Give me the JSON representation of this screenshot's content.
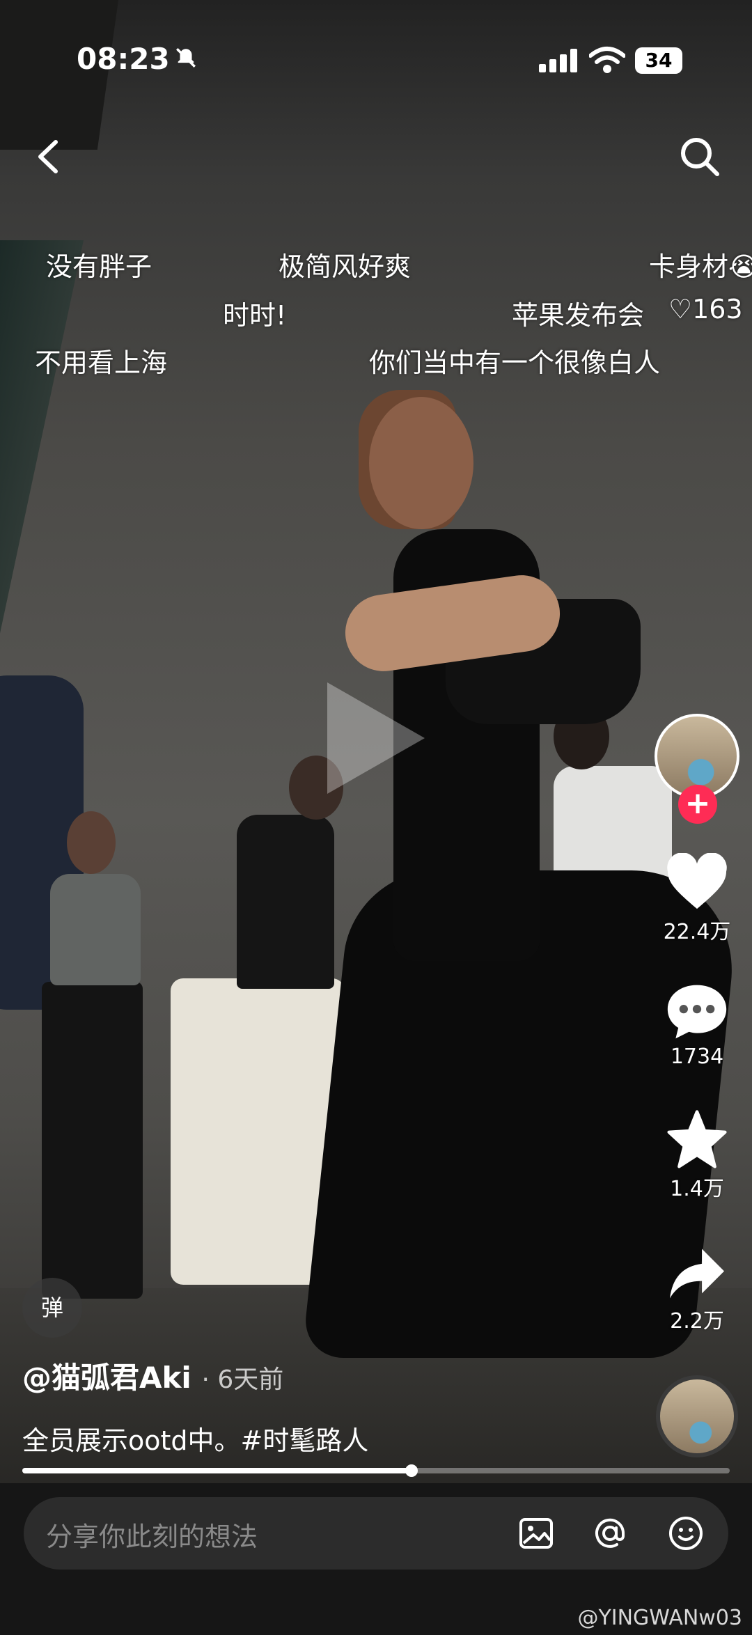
{
  "status_bar": {
    "time": "08:23",
    "battery": "34"
  },
  "danmaku": [
    "没有胖子",
    "极简风好爽",
    "卡身材😭",
    "时时!",
    "苹果发布会",
    "♡163",
    "不用看上海",
    "你们当中有一个很像白人"
  ],
  "rail": {
    "likes": "22.4万",
    "comments": "1734",
    "favorites": "1.4万",
    "shares": "2.2万"
  },
  "video": {
    "danmaku_toggle": "弹",
    "author": "@猫弧君Aki",
    "posted": "6天前",
    "caption": "全员展示ootd中。#时髦路人",
    "progress": 0.55
  },
  "comment_bar": {
    "placeholder": "分享你此刻的想法"
  },
  "watermark": "@YINGWANw03",
  "colors": {
    "follow": "#fe2c55"
  },
  "icons": [
    "back-icon",
    "search-icon",
    "heart-icon",
    "comment-icon",
    "star-icon",
    "share-icon",
    "image-icon",
    "at-icon",
    "emoji-icon",
    "mute-bell-icon"
  ]
}
